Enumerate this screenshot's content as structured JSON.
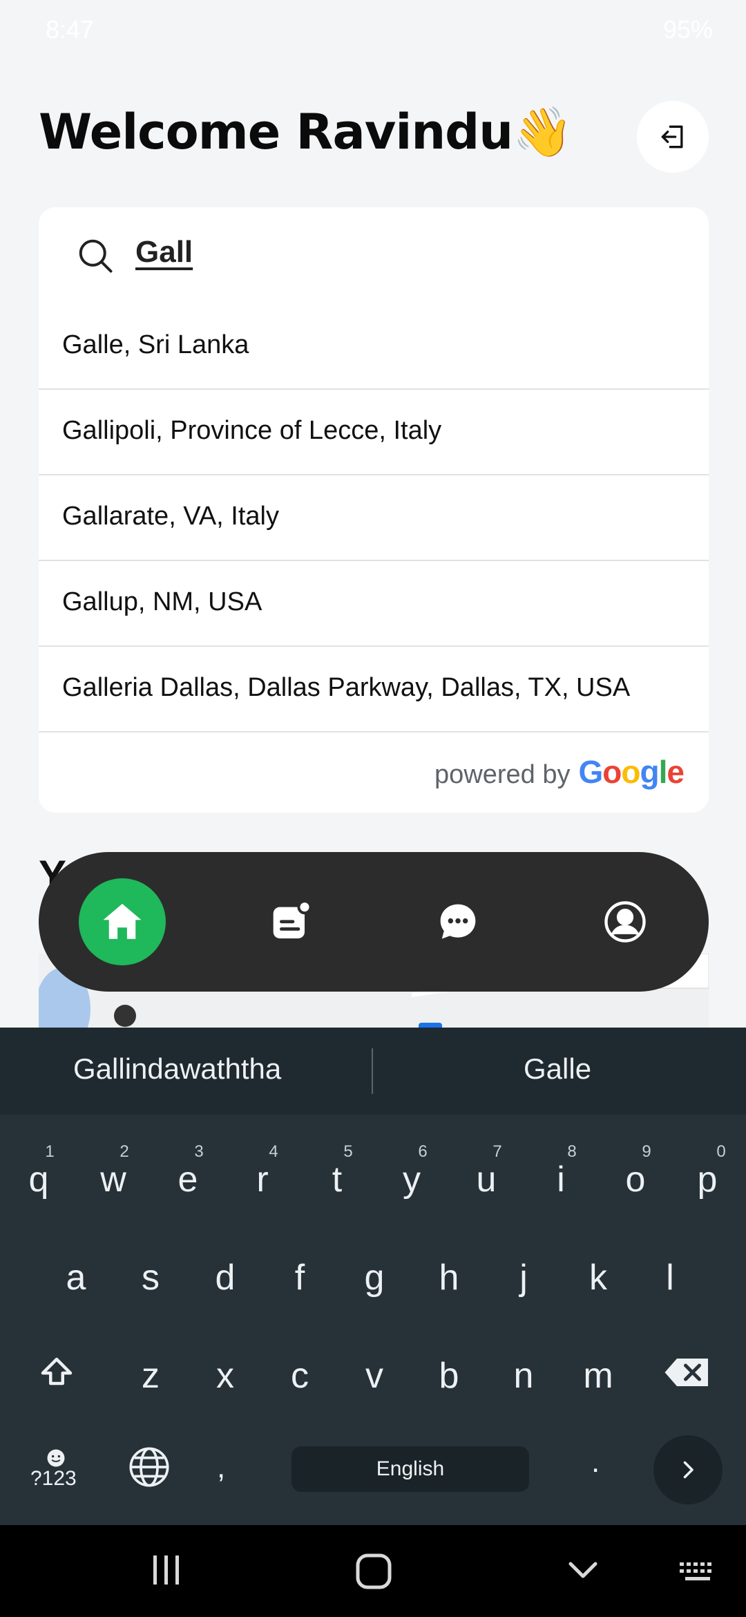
{
  "status_bar": {
    "time": "8:47",
    "battery": "95%"
  },
  "header": {
    "title": "Welcome Ravindu👋"
  },
  "search": {
    "query": "Gall",
    "results": [
      "Galle, Sri Lanka",
      "Gallipoli, Province of Lecce, Italy",
      "Gallarate, VA, Italy",
      "Gallup, NM, USA",
      "Galleria Dallas, Dallas Parkway, Dallas, TX, USA"
    ],
    "powered_by": "powered by",
    "provider": "Google"
  },
  "section_peek": "Y",
  "nav": {
    "items": [
      "home-icon",
      "notes-icon",
      "chat-icon",
      "profile-icon"
    ],
    "active_color": "#1fb85a"
  },
  "keyboard": {
    "suggestions": [
      "Gallindawaththa",
      "Galle"
    ],
    "row1": [
      "q",
      "w",
      "e",
      "r",
      "t",
      "y",
      "u",
      "i",
      "o",
      "p"
    ],
    "row1_nums": [
      "1",
      "2",
      "3",
      "4",
      "5",
      "6",
      "7",
      "8",
      "9",
      "0"
    ],
    "row2": [
      "a",
      "s",
      "d",
      "f",
      "g",
      "h",
      "j",
      "k",
      "l"
    ],
    "row3": [
      "z",
      "x",
      "c",
      "v",
      "b",
      "n",
      "m"
    ],
    "symbols_key": "?123",
    "comma": ",",
    "space_label": "English",
    "period": "."
  }
}
